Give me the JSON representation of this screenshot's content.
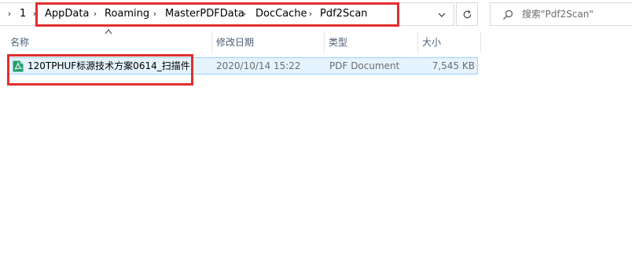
{
  "address": {
    "root_segment": "1",
    "crumbs": [
      "AppData",
      "Roaming",
      "MasterPDFData",
      "DocCache",
      "Pdf2Scan"
    ]
  },
  "search": {
    "placeholder": "搜索\"Pdf2Scan\""
  },
  "columns": {
    "name": "名称",
    "modified": "修改日期",
    "type": "类型",
    "size": "大小"
  },
  "files": [
    {
      "name": "120TPHUF标源技术方案0614_扫描件",
      "modified": "2020/10/14 15:22",
      "type": "PDF Document",
      "size": "7,545 KB",
      "icon": "pdf-file-icon"
    }
  ],
  "colors": {
    "highlight_box": "#e02e2e",
    "selection_bg": "#e5f3ff",
    "selection_border": "#99d1ff",
    "pdf_icon": "#22a06b"
  }
}
